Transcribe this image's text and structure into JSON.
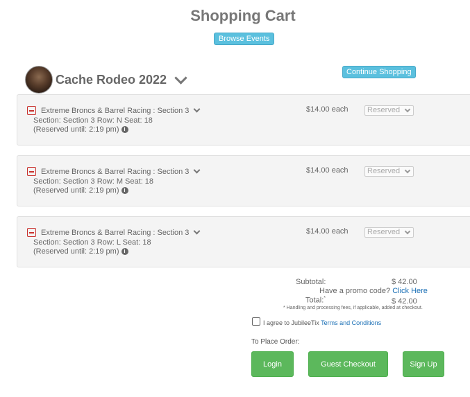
{
  "page": {
    "title": "Shopping Cart",
    "browse_label": "Browse Events"
  },
  "event": {
    "name": "Cache Rodeo 2022",
    "continue_label": "Continue Shopping"
  },
  "items": [
    {
      "title": "Extreme Broncs & Barrel Racing : Section 3",
      "seat": "Section: Section 3 Row: N Seat: 18",
      "reserved": "(Reserved until: 2:19 pm)",
      "price": "$14.00 each",
      "status": "Reserved"
    },
    {
      "title": "Extreme Broncs & Barrel Racing : Section 3",
      "seat": "Section: Section 3 Row: M Seat: 18",
      "reserved": "(Reserved until: 2:19 pm)",
      "price": "$14.00 each",
      "status": "Reserved"
    },
    {
      "title": "Extreme Broncs & Barrel Racing : Section 3",
      "seat": "Section: Section 3 Row: L Seat: 18",
      "reserved": "(Reserved until: 2:19 pm)",
      "price": "$14.00 each",
      "status": "Reserved"
    }
  ],
  "summary": {
    "subtotal_label": "Subtotal:",
    "subtotal_value": "$ 42.00",
    "promo_question": "Have a promo code?",
    "promo_link": "Click Here",
    "total_label": "Total:",
    "total_marker": "*",
    "total_value": "$ 42.00",
    "fine_print": "* Handling and processing fees, if applicable, added at checkout."
  },
  "agree": {
    "text": "I agree to JubileeTix",
    "link": "Terms and Conditions"
  },
  "order": {
    "label": "To Place Order:",
    "login": "Login",
    "guest": "Guest Checkout",
    "signup": "Sign Up"
  },
  "colors": {
    "info": "#5bc0de",
    "success": "#5cb85c",
    "danger": "#c9302c",
    "link": "#1a6fb5"
  },
  "icons": {
    "remove": "minus-square-icon",
    "expand": "chevron-down-icon",
    "info": "info-circle-icon"
  }
}
